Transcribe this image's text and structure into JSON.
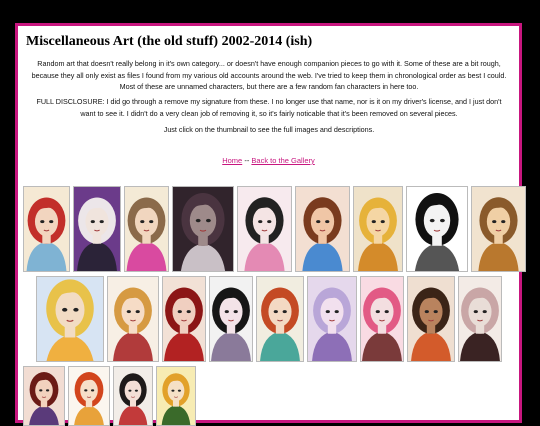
{
  "page": {
    "title": "Miscellaneous Art (the old stuff) 2002-2014 (ish)",
    "intro": "Random art that doesn't really belong in it's own category... or doesn't have enough companion pieces to go with it. Some of these are a bit rough, because they all only exist as files I found from my various old accounts around the web. I've tried to keep them in chronological order as best I could. Most of these are unnamed characters, but there are a few random fan characters in here too.",
    "disclosure": "FULL DISCLOSURE: I did go through a remove my signature from these. I no longer use that name, nor is it on my driver's license, and I just don't want to see it. I didn't do a very clean job of removing it, so it's fairly noticable that it's been removed on several pieces.",
    "instructions": "Just click on the thumbnail to see the full images and descriptions.",
    "nav": {
      "home": "Home",
      "separator": " -- ",
      "back": "Back to the Gallery"
    }
  },
  "colors": {
    "frame": "#c8167f",
    "link": "#c8167f",
    "background": "#000000"
  },
  "thumbnails": [
    {
      "bg": "#f5e9d4",
      "hair": "#c22f2a",
      "skin": "#f2d5bf",
      "accent": "#7fb3d3"
    },
    {
      "bg": "#6b3b8a",
      "hair": "#ece6e9",
      "skin": "#f0e4dd",
      "accent": "#2b2338"
    },
    {
      "bg": "#f4ead6",
      "hair": "#8b6a4a",
      "skin": "#f1d6bf",
      "accent": "#d94aa0"
    },
    {
      "bg": "#31242c",
      "hair": "#4a3440",
      "skin": "#9e8a8a",
      "accent": "#c9c0c6"
    },
    {
      "bg": "#f7eaee",
      "hair": "#222222",
      "skin": "#f4e4e4",
      "accent": "#e48ab4"
    },
    {
      "bg": "#f3dfd2",
      "hair": "#7a3b1e",
      "skin": "#f0c6a6",
      "accent": "#4a8ad0"
    },
    {
      "bg": "#efe2c9",
      "hair": "#e6b23a",
      "skin": "#f5d6a4",
      "accent": "#d48b2a"
    },
    {
      "bg": "#ffffff",
      "hair": "#111111",
      "skin": "#f3f3f3",
      "accent": "#555555"
    },
    {
      "bg": "#f1e3cf",
      "hair": "#8a5a2b",
      "skin": "#f0cfa5",
      "accent": "#b9782e"
    },
    {
      "bg": "#d7e4f3",
      "hair": "#e8c24a",
      "skin": "#f2dcc4",
      "accent": "#f0b040"
    },
    {
      "bg": "#f7efe5",
      "hair": "#d69a42",
      "skin": "#f6dcc6",
      "accent": "#b13b3b"
    },
    {
      "bg": "#f2e1d6",
      "hair": "#8c1616",
      "skin": "#f0cfc0",
      "accent": "#b22222"
    },
    {
      "bg": "#f2f2f2",
      "hair": "#161616",
      "skin": "#f3e3e8",
      "accent": "#8a7a9a"
    },
    {
      "bg": "#f1ede0",
      "hair": "#c44a24",
      "skin": "#f3d9c3",
      "accent": "#4aa79a"
    },
    {
      "bg": "#e5d8ec",
      "hair": "#b9a6d8",
      "skin": "#f2e0ee",
      "accent": "#8d6fb7"
    },
    {
      "bg": "#f9dbe3",
      "hair": "#e25a85",
      "skin": "#f3dee0",
      "accent": "#7a3a3a"
    },
    {
      "bg": "#efdfd1",
      "hair": "#3b2417",
      "skin": "#b9835e",
      "accent": "#d35b2b"
    },
    {
      "bg": "#f3ebe6",
      "hair": "#c9a6a6",
      "skin": "#e9ddd7",
      "accent": "#3a2323"
    },
    {
      "bg": "#f2ddd3",
      "hair": "#6b1b16",
      "skin": "#f2d2be",
      "accent": "#5a3a7a"
    },
    {
      "bg": "#fbf6ef",
      "hair": "#d2451d",
      "skin": "#f6dfc9",
      "accent": "#e8a23a"
    },
    {
      "bg": "#f2ede8",
      "hair": "#1e1a1a",
      "skin": "#f4dfd6",
      "accent": "#c23a3a"
    },
    {
      "bg": "#f7ecb3",
      "hair": "#e2a12a",
      "skin": "#f5e0c6",
      "accent": "#3a6a2a"
    }
  ]
}
